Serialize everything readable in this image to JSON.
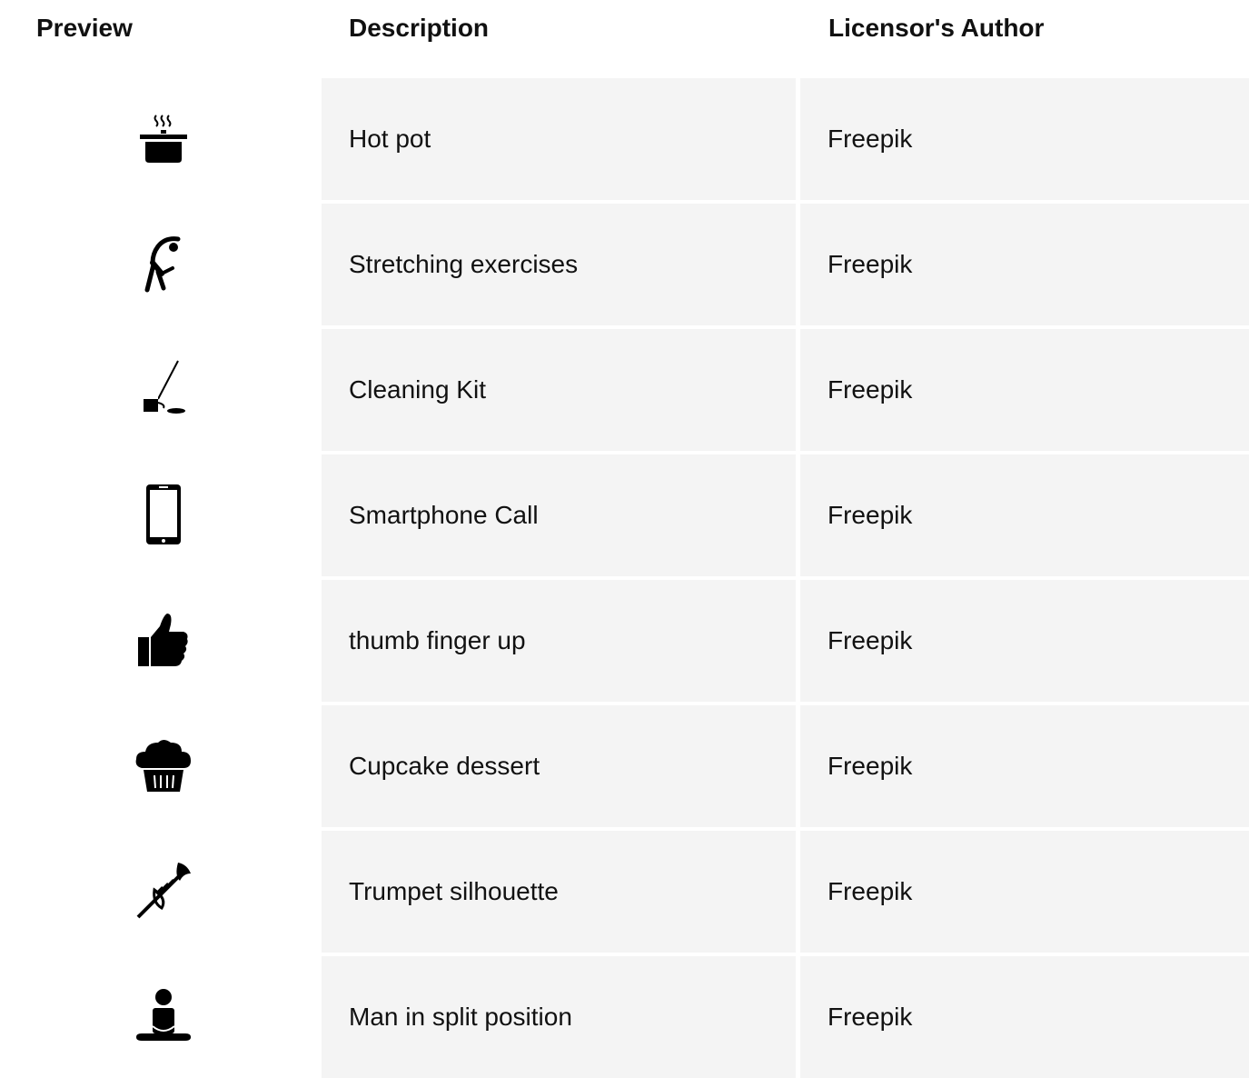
{
  "table": {
    "headers": {
      "preview": "Preview",
      "description": "Description",
      "author": "Licensor's Author"
    },
    "rows": [
      {
        "icon": "hot-pot-icon",
        "description": "Hot pot",
        "author": "Freepik"
      },
      {
        "icon": "stretching-exercise-icon",
        "description": "Stretching exercises",
        "author": "Freepik"
      },
      {
        "icon": "cleaning-kit-icon",
        "description": "Cleaning Kit",
        "author": "Freepik"
      },
      {
        "icon": "smartphone-icon",
        "description": "Smartphone Call",
        "author": "Freepik"
      },
      {
        "icon": "thumb-up-icon",
        "description": "thumb finger up",
        "author": "Freepik"
      },
      {
        "icon": "cupcake-icon",
        "description": "Cupcake dessert",
        "author": "Freepik"
      },
      {
        "icon": "trumpet-icon",
        "description": "Trumpet silhouette",
        "author": "Freepik"
      },
      {
        "icon": "man-split-position-icon",
        "description": "Man in split position",
        "author": "Freepik"
      }
    ]
  },
  "colors": {
    "cell_background": "#f4f4f4",
    "text": "#111111",
    "icon": "#000000"
  }
}
